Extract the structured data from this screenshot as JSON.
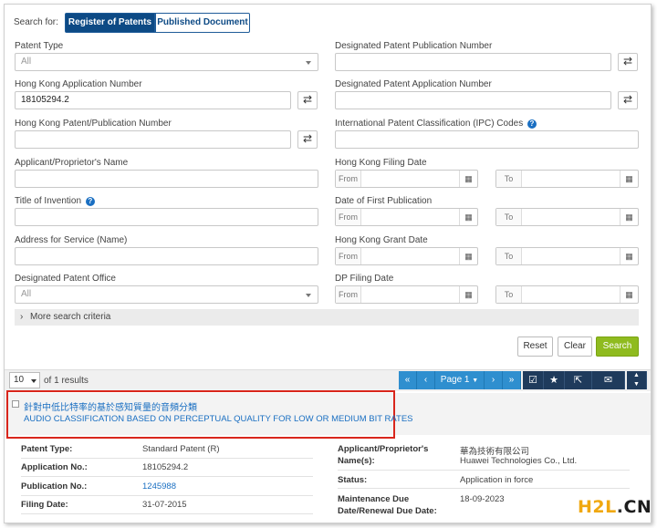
{
  "search": {
    "label": "Search for:",
    "tab_register": "Register of Patents",
    "tab_published": "Published Document"
  },
  "form": {
    "patent_type_label": "Patent Type",
    "patent_type_value": "All",
    "hk_app_no_label": "Hong Kong Application Number",
    "hk_app_no_value": "18105294.2",
    "hk_pub_no_label": "Hong Kong Patent/Publication Number",
    "applicant_label": "Applicant/Proprietor's Name",
    "title_label": "Title of Invention",
    "address_label": "Address for Service (Name)",
    "dp_office_label": "Designated Patent Office",
    "dp_office_value": "All",
    "dp_pub_no_label": "Designated Patent Publication Number",
    "dp_app_no_label": "Designated Patent Application Number",
    "ipc_label": "International Patent Classification (IPC) Codes",
    "hk_filing_label": "Hong Kong Filing Date",
    "first_pub_label": "Date of First Publication",
    "grant_label": "Hong Kong Grant Date",
    "dp_filing_label": "DP Filing Date",
    "from": "From",
    "to": "To",
    "more_criteria": "More search criteria",
    "swap_glyph": "⇄",
    "help_glyph": "?",
    "cal_glyph": "▦"
  },
  "actions": {
    "reset": "Reset",
    "clear": "Clear",
    "search": "Search"
  },
  "results": {
    "per_page": "10",
    "count_text": "of 1 results",
    "page_label": "Page 1",
    "first": "«",
    "prev": "‹",
    "next": "›",
    "last": "»",
    "check_glyph": "☑",
    "star_glyph": "★",
    "export_glyph": "⇱",
    "mail_glyph": "✉",
    "up_glyph": "▲",
    "down_glyph": "▼"
  },
  "record": {
    "title_zh": "針對中低比特率的基於感知質量的音頻分類",
    "title_en": "AUDIO CLASSIFICATION BASED ON PERCEPTUAL QUALITY FOR LOW OR MEDIUM BIT RATES",
    "fields_left": [
      {
        "label": "Patent Type:",
        "value": "Standard Patent (R)",
        "link": false
      },
      {
        "label": "Application No.:",
        "value": "18105294.2",
        "link": false
      },
      {
        "label": "Publication No.:",
        "value": "1245988",
        "link": true
      },
      {
        "label": "Filing Date:",
        "value": "31-07-2015",
        "link": false
      }
    ],
    "applicant_label_1": "Applicant/Proprietor's",
    "applicant_label_2": "Name(s):",
    "applicant_zh": "華為技術有限公司",
    "applicant_en": "Huawei Technologies Co., Ltd.",
    "status_label": "Status:",
    "status_value": "Application in force",
    "maint_label_1": "Maintenance Due",
    "maint_label_2": "Date/Renewal Due Date:",
    "maint_value": "18-09-2023"
  },
  "watermark": {
    "main": "H2L",
    "dot": ".",
    "cn": "CN"
  },
  "colors": {
    "brand_dark": "#0d4a85",
    "pager_blue": "#2f8fcf",
    "search_green": "#8fbb1f",
    "link_blue": "#1a6fc2",
    "highlight_red": "#d9261c"
  }
}
